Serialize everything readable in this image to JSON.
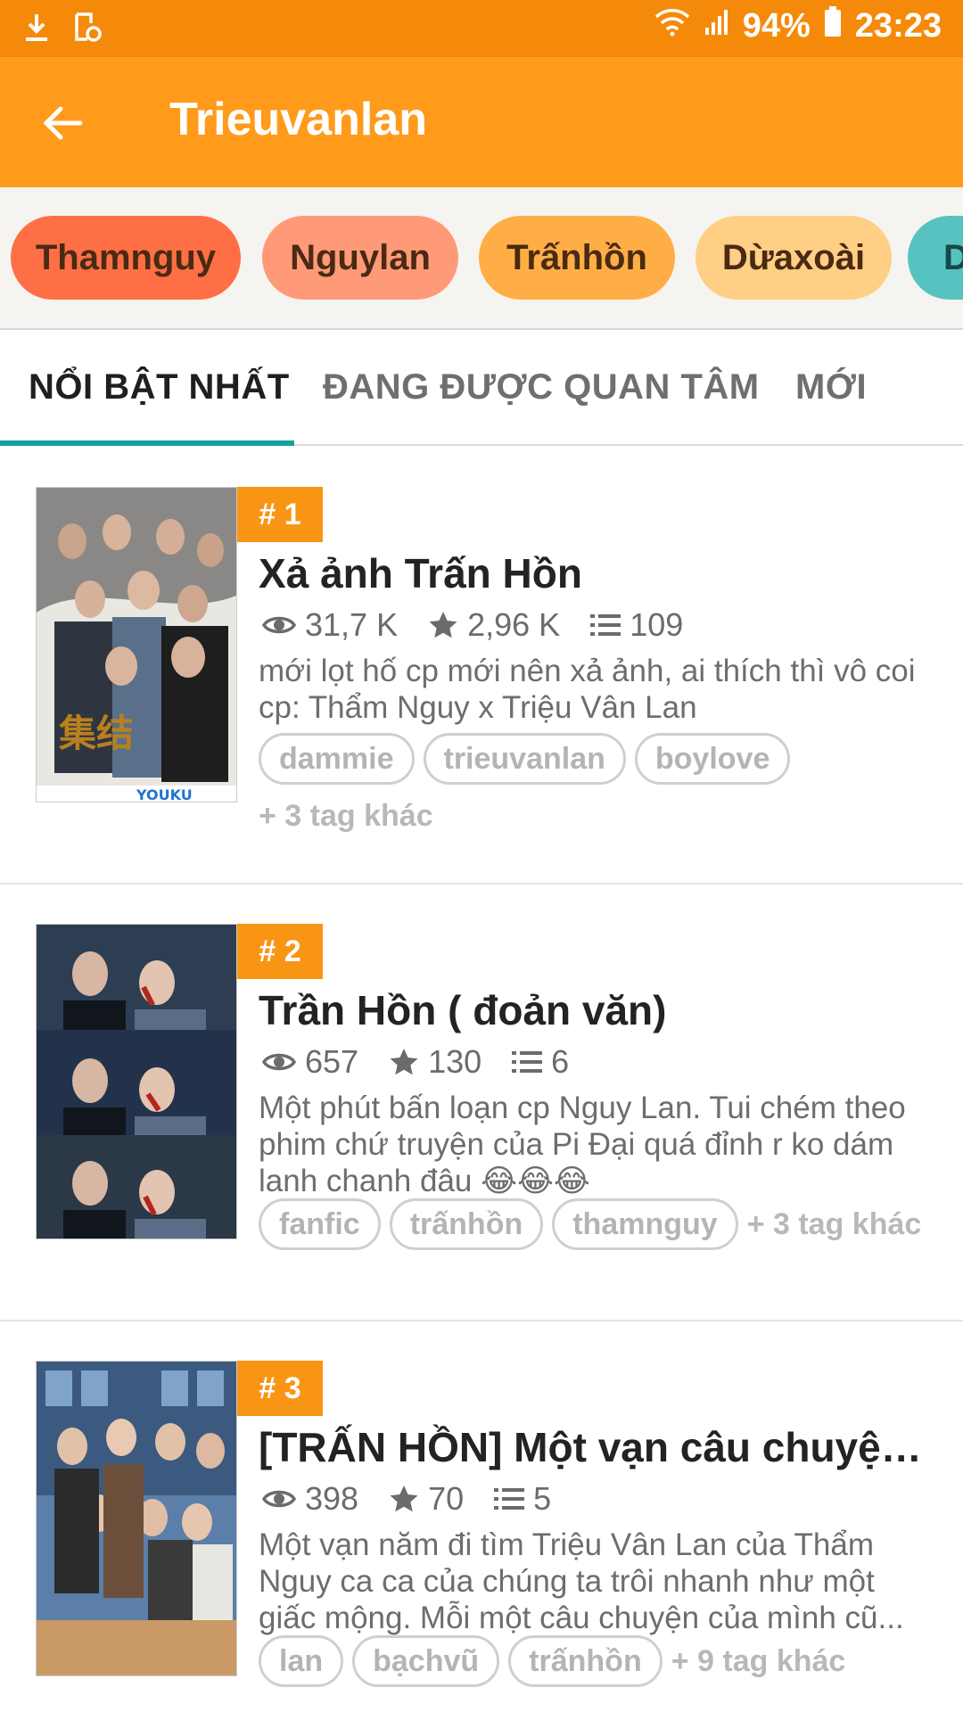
{
  "status_bar": {
    "left_icons": [
      "download-icon",
      "sync-file-icon"
    ],
    "right_icons": [
      "wifi-icon",
      "signal-icon",
      "battery-icon"
    ],
    "battery": "94%",
    "time": "23:23"
  },
  "app_bar": {
    "back_icon": "arrow-left-icon",
    "title": "Trieuvanlan"
  },
  "chips": [
    {
      "label": "Thamnguy",
      "color": "#ff6f45"
    },
    {
      "label": "Nguylan",
      "color": "#ff9a78"
    },
    {
      "label": "Trấnhồn",
      "color": "#ffae45"
    },
    {
      "label": "Dừaxoài",
      "color": "#ffcf86"
    },
    {
      "label": "D",
      "color": "#56c3c0"
    }
  ],
  "tabs": [
    {
      "label": "NỔI BẬT NHẤT",
      "active": true
    },
    {
      "label": "ĐANG ĐƯỢC QUAN TÂM",
      "active": false
    },
    {
      "label": "MỚI",
      "active": false
    }
  ],
  "stories": [
    {
      "rank": "# 1",
      "title": "Xả ảnh Trấn Hồn",
      "views": "31,7 K",
      "stars": "2,96 K",
      "parts": "109",
      "description": "mới lọt hố cp mới nên xả ảnh, ai thích thì vô coi cp: Thẩm Nguy x Triệu Vân Lan",
      "tags": [
        "dammie",
        "trieuvanlan",
        "boylove"
      ],
      "more_tags": "+ 3 tag khác"
    },
    {
      "rank": "# 2",
      "title": "Trần Hồn ( đoản văn)",
      "views": "657",
      "stars": "130",
      "parts": "6",
      "description": "Một phút bấn loạn cp Nguy Lan. Tui chém theo phim chứ truyện của Pi Đại quá đỉnh r ko dám lanh chanh đâu 😂😂😂",
      "tags": [
        "fanfic",
        "trấnhồn",
        "thamnguy"
      ],
      "more_tags": "+ 3 tag khác"
    },
    {
      "rank": "# 3",
      "title": "[TRẤN HỒN] Một vạn câu chuyện li...",
      "views": "398",
      "stars": "70",
      "parts": "5",
      "description": "Một vạn năm đi tìm Triệu Vân Lan của Thẩm Nguy ca ca của chúng ta trôi nhanh như một giấc mộng. Mỗi một câu chuyện của mình cũ...",
      "tags": [
        "lan",
        "bạchvũ",
        "trấnhồn"
      ],
      "more_tags": "+ 9 tag khác"
    }
  ]
}
